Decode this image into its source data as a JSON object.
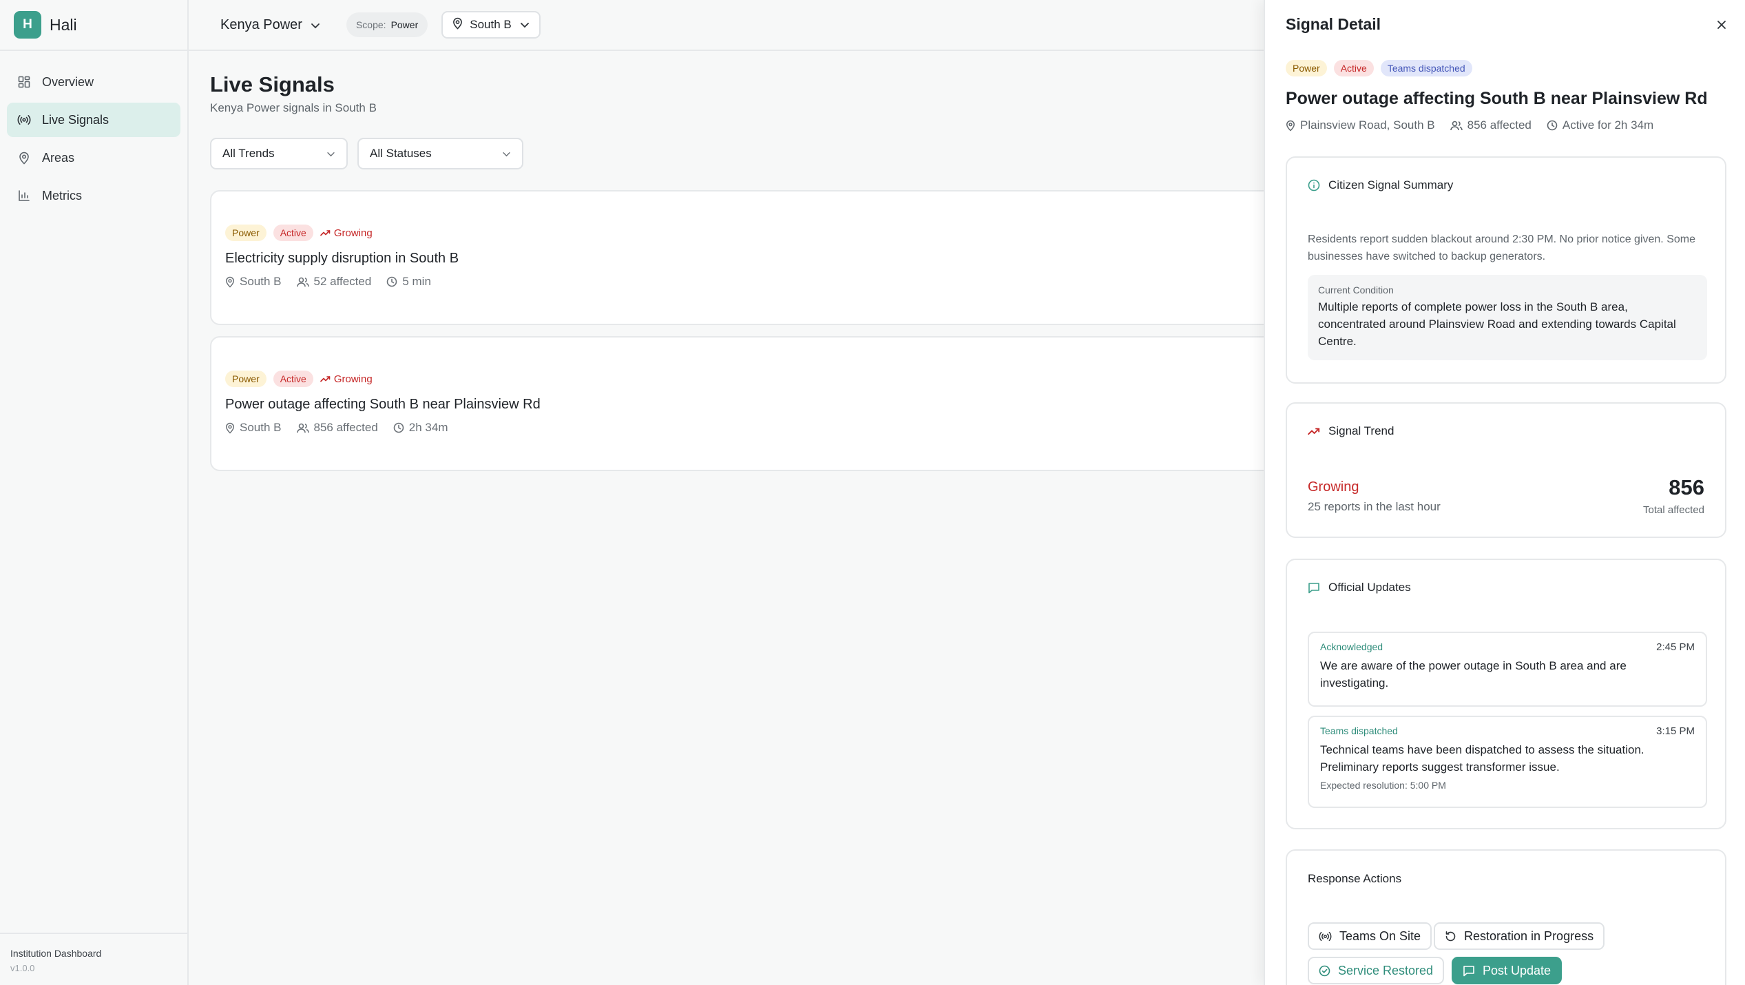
{
  "brand": {
    "initial": "H",
    "name": "Hali"
  },
  "sidebar": {
    "items": [
      {
        "label": "Overview",
        "icon": "dashboard-icon",
        "active": false
      },
      {
        "label": "Live Signals",
        "icon": "broadcast-icon",
        "active": true
      },
      {
        "label": "Areas",
        "icon": "map-pin-icon",
        "active": false
      },
      {
        "label": "Metrics",
        "icon": "bar-chart-icon",
        "active": false
      }
    ],
    "footer": {
      "title": "Institution Dashboard",
      "version": "v1.0.0"
    }
  },
  "topbar": {
    "org": "Kenya Power",
    "scope_key": "Scope:",
    "scope_value": "Power",
    "area": "South B"
  },
  "page": {
    "title": "Live Signals",
    "subtitle": "Kenya Power signals in South B",
    "filters": {
      "trend": "All Trends",
      "status": "All Statuses"
    }
  },
  "signals": [
    {
      "category": "Power",
      "status": "Active",
      "trend": "Growing",
      "title": "Electricity supply disruption in South B",
      "area": "South B",
      "affected": "52 affected",
      "duration": "5 min"
    },
    {
      "category": "Power",
      "status": "Active",
      "trend": "Growing",
      "title": "Power outage affecting South B near Plainsview Rd",
      "area": "South B",
      "affected": "856 affected",
      "duration": "2h 34m"
    }
  ],
  "detail": {
    "header": "Signal Detail",
    "tags": {
      "category": "Power",
      "status": "Active",
      "phase": "Teams dispatched"
    },
    "title": "Power outage affecting South B near Plainsview Rd",
    "location": "Plainsview Road, South B",
    "affected": "856 affected",
    "active_for": "Active for 2h 34m",
    "summary": {
      "heading": "Citizen Signal Summary",
      "text": "Residents report sudden blackout around 2:30 PM. No prior notice given. Some businesses have switched to backup generators.",
      "condition_label": "Current Condition",
      "condition_text": "Multiple reports of complete power loss in the South B area, concentrated around Plainsview Road and extending towards Capital Centre."
    },
    "trend": {
      "heading": "Signal Trend",
      "label": "Growing",
      "sub": "25 reports in the last hour",
      "total": "856",
      "total_label": "Total affected"
    },
    "updates": {
      "heading": "Official Updates",
      "items": [
        {
          "status": "Acknowledged",
          "time": "2:45 PM",
          "text": "We are aware of the power outage in South B area and are investigating."
        },
        {
          "status": "Teams dispatched",
          "time": "3:15 PM",
          "text": "Technical teams have been dispatched to assess the situation. Preliminary reports suggest transformer issue.",
          "extra": "Expected resolution: 5:00 PM"
        }
      ]
    },
    "actions": {
      "heading": "Response Actions",
      "teams_on_site": "Teams On Site",
      "restoration": "Restoration in Progress",
      "restored": "Service Restored",
      "post_update": "Post Update"
    }
  },
  "colors": {
    "accent": "#3c9f8c",
    "danger": "#c62828",
    "power_tag_bg": "#fdf3d6",
    "active_tag_bg": "#fbe1e1",
    "teams_tag_bg": "#e1e6fa"
  }
}
